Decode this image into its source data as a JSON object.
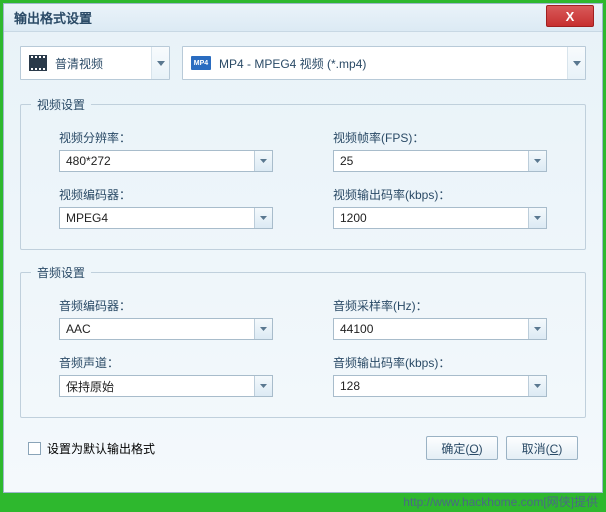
{
  "window": {
    "title": "输出格式设置"
  },
  "top": {
    "category": "普清视频",
    "format": "MP4 - MPEG4 视频 (*.mp4)"
  },
  "video_section": {
    "legend": "视频设置",
    "resolution": {
      "label": "视频分辨率：",
      "value": "480*272"
    },
    "fps": {
      "label": "视频帧率(FPS)：",
      "value": "25"
    },
    "encoder": {
      "label": "视频编码器：",
      "value": "MPEG4"
    },
    "bitrate": {
      "label": "视频输出码率(kbps)：",
      "value": "1200"
    }
  },
  "audio_section": {
    "legend": "音频设置",
    "encoder": {
      "label": "音频编码器：",
      "value": "AAC"
    },
    "samplerate": {
      "label": "音频采样率(Hz)：",
      "value": "44100"
    },
    "channel": {
      "label": "音频声道：",
      "value": "保持原始"
    },
    "bitrate": {
      "label": "音频输出码率(kbps)：",
      "value": "128"
    }
  },
  "default_checkbox": "设置为默认输出格式",
  "buttons": {
    "ok": "确定",
    "ok_key": "O",
    "cancel": "取消",
    "cancel_key": "C"
  },
  "footer": "http://www.hackhome.com[网侠]提供"
}
